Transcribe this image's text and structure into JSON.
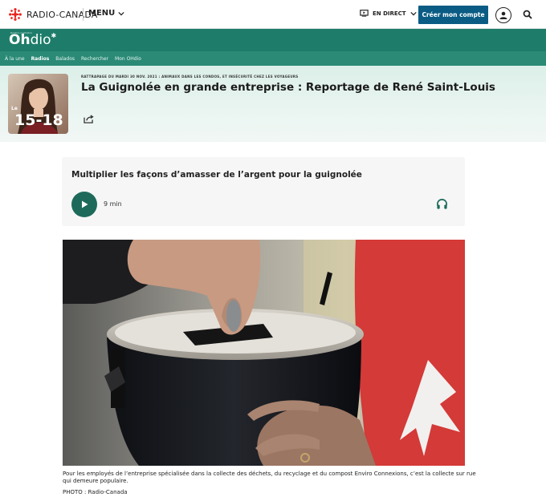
{
  "header": {
    "logo_text": "RADIO-CANADA",
    "menu_label": "MENU",
    "direct_label": "EN DIRECT",
    "create_account_label": "Créer mon compte"
  },
  "ohdio": {
    "small_label": "RADIO-CANADA",
    "brand_bold": "Oh",
    "brand_rest": "dio"
  },
  "nav": {
    "items": [
      "À la une",
      "Radios",
      "Balados",
      "Rechercher",
      "Mon OHdio"
    ],
    "active_index": 1
  },
  "episode": {
    "thumb_label": "15-18",
    "thumb_prefix": "Le",
    "kicker": "RATTRAPAGE DU MARDI 30 NOV. 2021 : ANIMAUX DANS LES CONDOS, ET INSÉCURITÉ CHEZ LES VOYAGEURS",
    "title": "La Guignolée en grande entreprise : Reportage de René Saint-Louis"
  },
  "audio": {
    "title": "Multiplier les façons d’amasser de l’argent pour la guignolée",
    "duration": "9 min"
  },
  "photo": {
    "caption": "Pour les employés de l’entreprise spécialisée dans la collecte des déchets, du recyclage et du compost Enviro Connexions, c’est la collecte sur rue qui demeure populaire.",
    "credit": "PHOTO : Radio-Canada"
  },
  "colors": {
    "brand_red": "#e8261f",
    "ohdio_green": "#1e7d6a",
    "nav_green": "#2a8a76",
    "button_blue": "#0a5c84",
    "play_green": "#1d6a5b"
  },
  "icons": [
    "radio-canada-gem-icon",
    "chevron-down-icon",
    "tv-icon",
    "user-icon",
    "search-icon",
    "share-icon",
    "play-icon",
    "headphones-icon"
  ]
}
